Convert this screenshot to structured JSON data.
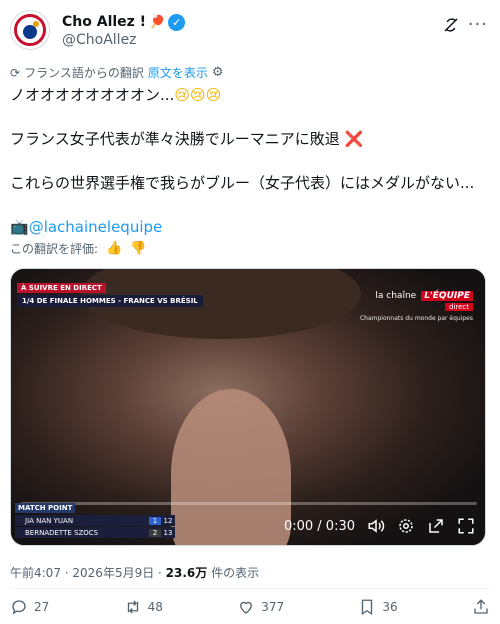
{
  "author": {
    "display_name": "Cho Allez !",
    "name_emoji": "🏓",
    "verified_glyph": "✓",
    "handle": "@ChoAllez"
  },
  "header_icons": [
    "grok-icon",
    "more-icon"
  ],
  "more_glyph": "···",
  "translation": {
    "icon_glyph": "⟳",
    "translated_from": "フランス語からの翻訳",
    "show_original": "原文を表示",
    "gear_glyph": "⚙"
  },
  "tweet": {
    "line1": "ノオオオオオオオオン...",
    "line1_emoji": "😢😢😢",
    "line2": "フランス女子代表が準々決勝でルーマニアに敗退",
    "line2_mark": "❌",
    "line3": "これらの世界選手権で我らがブルー（女子代表）にはメダルがない...",
    "line4_icon": "📺",
    "line4_link": "@lachainelequipe"
  },
  "rate_translation": {
    "label": "この翻訳を評価:",
    "up_glyph": "👍",
    "down_glyph": "👎"
  },
  "video": {
    "live_tag": "À SUIVRE EN DIRECT",
    "match_title": "1/4 DE FINALE HOMMES - FRANCE VS BRÉSIL",
    "channel_la": "la chaîne",
    "channel_brand": "L'ÉQUIPE",
    "channel_direct": "direct",
    "channel_sub": "Championnats du monde par équipes",
    "match_point": "MATCH POINT",
    "players": [
      {
        "name": "JIA NAN YUAN",
        "games": "1",
        "points": "12"
      },
      {
        "name": "BERNADETTE SZOCS",
        "games": "2",
        "points": "13"
      }
    ],
    "time": "0:00 / 0:30",
    "progress": 0.0
  },
  "meta": {
    "time": "午前4:07",
    "separator": " · ",
    "date": "2026年5月9日",
    "views": "23.6万",
    "views_label": " 件の表示"
  },
  "actions": {
    "replies": "27",
    "reposts": "48",
    "likes": "377",
    "bookmarks": "36"
  },
  "colors": {
    "accent": "#1d9bf0",
    "text": "#0f1419",
    "muted": "#536471",
    "brand_red": "#d0021b"
  }
}
